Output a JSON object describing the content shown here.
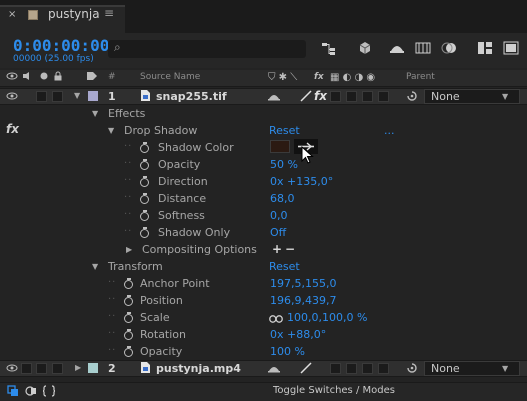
{
  "tab": {
    "close": "×",
    "title": "pustynja",
    "menu": "≡"
  },
  "header": {
    "timecode": "0:00:00:00",
    "fps": "00000 (25.00 fps)",
    "search_placeholder": "",
    "search_icon_glyph": "⌕",
    "icons": [
      "comp-flowchart-icon",
      "3d-draft-icon",
      "shy-icon",
      "frame-blending-icon",
      "motion-blur-icon",
      "graph-editor-icon",
      "live-update-icon"
    ]
  },
  "columns": {
    "num": "#",
    "source_name": "Source Name",
    "fx": "fx",
    "parent": "Parent"
  },
  "layers": [
    {
      "index": "1",
      "name": "snap255.tif",
      "parent": "None",
      "label_color": "#a8a8ce"
    },
    {
      "index": "2",
      "name": "pustynja.mp4",
      "parent": "None",
      "label_color": "#a8cece"
    }
  ],
  "effects": {
    "group_label": "Effects",
    "fx_badge": "fx",
    "drop_shadow": {
      "label": "Drop Shadow",
      "reset": "Reset",
      "ellipsis": "...",
      "properties": [
        {
          "name": "Shadow Color",
          "value": "",
          "swatch": "#2b1a12"
        },
        {
          "name": "Opacity",
          "value": "50 %"
        },
        {
          "name": "Direction",
          "value": "0x +135,0°"
        },
        {
          "name": "Distance",
          "value": "68,0"
        },
        {
          "name": "Softness",
          "value": "0,0"
        },
        {
          "name": "Shadow Only",
          "value": "Off"
        }
      ],
      "compositing": {
        "label": "Compositing Options",
        "plus": "+",
        "minus": "−"
      }
    }
  },
  "transform": {
    "label": "Transform",
    "reset": "Reset",
    "properties": [
      {
        "name": "Anchor Point",
        "value": "197,5,155,0"
      },
      {
        "name": "Position",
        "value": "196,9,439,7"
      },
      {
        "name": "Scale",
        "value": "100,0,100,0 %"
      },
      {
        "name": "Rotation",
        "value": "0x +88,0°"
      },
      {
        "name": "Opacity",
        "value": "100 %"
      }
    ]
  },
  "footer": {
    "toggle": "Toggle Switches / Modes"
  },
  "colors": {
    "accent": "#2d8ceb",
    "panel": "#232323"
  }
}
